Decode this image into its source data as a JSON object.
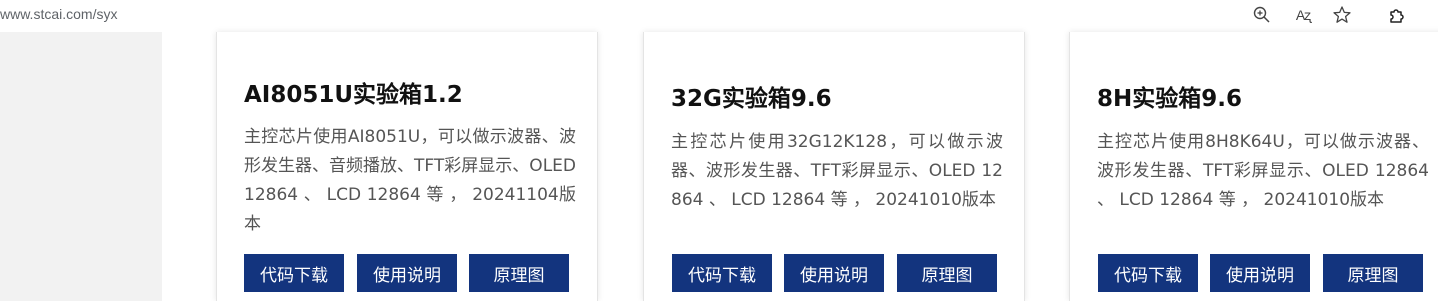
{
  "browser": {
    "url": "www.stcai.com/syx",
    "icons": [
      "zoom-icon",
      "read-aloud-icon",
      "favorite-star-icon",
      "extensions-icon"
    ],
    "read_aloud_label": "Aʐ"
  },
  "colors": {
    "button_bg": "#13347e",
    "button_text": "#ffffff",
    "page_bg": "#f2f2f2"
  },
  "cards": [
    {
      "title": "AI8051U实验箱1.2",
      "description": "主控芯片使用AI8051U，可以做示波器、波形发生器、音频播放、TFT彩屏显示、OLED 12864 、 LCD 12864 等 ， 20241104版本",
      "buttons": [
        "代码下载",
        "使用说明",
        "原理图"
      ]
    },
    {
      "title": "32G实验箱9.6",
      "description": "主控芯片使用32G12K128，可以做示波器、波形发生器、TFT彩屏显示、OLED 12864 、 LCD 12864 等 ， 20241010版本",
      "buttons": [
        "代码下载",
        "使用说明",
        "原理图"
      ]
    },
    {
      "title": "8H实验箱9.6",
      "description": "主控芯片使用8H8K64U，可以做示波器、波形发生器、TFT彩屏显示、OLED 12864 、 LCD 12864 等 ， 20241010版本",
      "buttons": [
        "代码下载",
        "使用说明",
        "原理图"
      ]
    }
  ]
}
